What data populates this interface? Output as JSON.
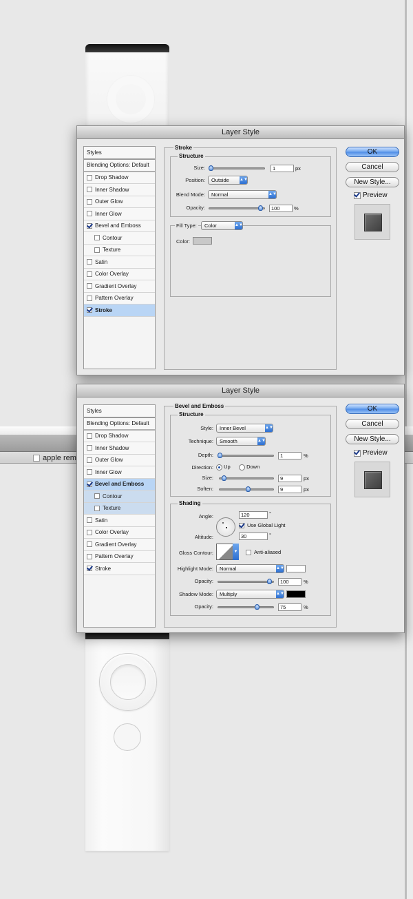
{
  "dialog_title": "Layer Style",
  "style_list": {
    "header": "Styles",
    "blending": "Blending Options: Default",
    "items": [
      "Drop Shadow",
      "Inner Shadow",
      "Outer Glow",
      "Inner Glow",
      "Bevel and Emboss",
      "Contour",
      "Texture",
      "Satin",
      "Color Overlay",
      "Gradient Overlay",
      "Pattern Overlay",
      "Stroke"
    ]
  },
  "buttons": {
    "ok": "OK",
    "cancel": "Cancel",
    "new_style": "New Style...",
    "preview": "Preview"
  },
  "stroke": {
    "section": "Stroke",
    "structure": "Structure",
    "size_label": "Size:",
    "size_value": "1",
    "size_unit": "px",
    "position_label": "Position:",
    "position_value": "Outside",
    "blend_label": "Blend Mode:",
    "blend_value": "Normal",
    "opacity_label": "Opacity:",
    "opacity_value": "100",
    "opacity_unit": "%",
    "opacity_level": 1.0,
    "size_level": 0.0,
    "fill_type_label": "Fill Type:",
    "fill_type_value": "Color",
    "color_label": "Color:",
    "color_value": "#c8c8c8"
  },
  "bevel": {
    "section": "Bevel and Emboss",
    "structure": "Structure",
    "style_label": "Style:",
    "style_value": "Inner Bevel",
    "technique_label": "Technique:",
    "technique_value": "Smooth",
    "depth_label": "Depth:",
    "depth_value": "1",
    "depth_unit": "%",
    "direction_label": "Direction:",
    "up": "Up",
    "down": "Down",
    "size_label": "Size:",
    "size_value": "9",
    "size_unit": "px",
    "soften_label": "Soften:",
    "soften_value": "9",
    "soften_unit": "px",
    "depth_level": 0.0,
    "size_level": 0.06,
    "soften_level": 0.55,
    "shading": "Shading",
    "angle_label": "Angle:",
    "angle_value": "120",
    "angle_unit": "°",
    "global_light": "Use Global Light",
    "altitude_label": "Altitude:",
    "altitude_value": "30",
    "altitude_unit": "°",
    "gloss_label": "Gloss Contour:",
    "anti_aliased": "Anti-aliased",
    "highlight_label": "Highlight Mode:",
    "highlight_value": "Normal",
    "highlight_color": "#ffffff",
    "hl_opacity_label": "Opacity:",
    "hl_opacity_value": "100",
    "hl_opacity_unit": "%",
    "hl_opacity_level": 1.0,
    "shadow_label": "Shadow Mode:",
    "shadow_value": "Multiply",
    "shadow_color": "#000000",
    "sh_opacity_label": "Opacity:",
    "sh_opacity_value": "75",
    "sh_opacity_unit": "%",
    "sh_opacity_level": 0.75
  },
  "background": {
    "tab_label": "apple rem"
  },
  "colors": {
    "accent": "#4c8be6",
    "selected_row": "#b9d5f5"
  }
}
